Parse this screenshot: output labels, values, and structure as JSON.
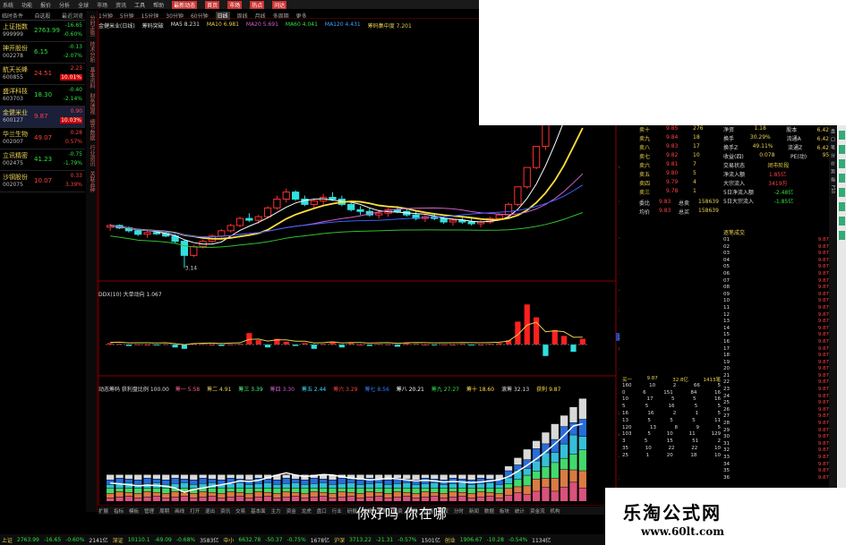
{
  "menu": [
    "系统",
    "功能",
    "报价",
    "分析",
    "全球",
    "市场",
    "资讯",
    "工具",
    "帮助",
    "最新动态",
    "首页",
    "市场",
    "热点",
    "问达"
  ],
  "left_header": {
    "col1": "临时条件",
    "col2": "自选股",
    "col3": "最近浏览"
  },
  "stocks": [
    {
      "name": "上证指数",
      "code": "999999",
      "price": "2763.99",
      "change": "-16.65",
      "pct": "-0.60%",
      "dir": "dn",
      "boxed": false,
      "selected": false
    },
    {
      "name": "神开股份",
      "code": "002278",
      "price": "6.15",
      "change": "-0.13",
      "pct": "-2.07%",
      "dir": "dn",
      "boxed": false,
      "selected": false
    },
    {
      "name": "航天长峰",
      "code": "600855",
      "price": "24.51",
      "change": "2.23",
      "pct": "10.01%",
      "dir": "up",
      "boxed": true,
      "selected": false
    },
    {
      "name": "盛洋科技",
      "code": "603703",
      "price": "18.30",
      "change": "-0.40",
      "pct": "-2.14%",
      "dir": "dn",
      "boxed": false,
      "selected": false
    },
    {
      "name": "金健米业",
      "code": "600127",
      "price": "9.87",
      "change": "0.90",
      "pct": "10.03%",
      "dir": "up",
      "boxed": true,
      "selected": true
    },
    {
      "name": "华兰生物",
      "code": "002007",
      "price": "49.07",
      "change": "0.28",
      "pct": "0.57%",
      "dir": "up",
      "boxed": false,
      "selected": false
    },
    {
      "name": "立讯精密",
      "code": "002475",
      "price": "41.23",
      "change": "-0.75",
      "pct": "-1.79%",
      "dir": "dn",
      "boxed": false,
      "selected": false
    },
    {
      "name": "沙钢股份",
      "code": "002075",
      "price": "10.07",
      "change": "0.33",
      "pct": "3.39%",
      "dir": "up",
      "boxed": false,
      "selected": false
    }
  ],
  "vtabs": [
    "分时走势",
    "技术分析",
    "基本资料",
    "财务透视",
    "细节数据",
    "行业资讯",
    "关联品种"
  ],
  "period_tabs": [
    "1分钟",
    "5分钟",
    "15分钟",
    "30分钟",
    "60分钟",
    "日线",
    "周线",
    "月线",
    "多周期",
    "更多"
  ],
  "active_period": "日线",
  "info": {
    "name": "金健米业(日线)",
    "ind": "筹码突破",
    "ma5": "MA5 8.231",
    "ma10": "MA10 6.981",
    "ma20": "MA20 5.691",
    "ma60": "MA60 4.041",
    "ma120": "MA120 4.431",
    "extra": "筹码集中度 7.201"
  },
  "price_labels": {
    "high": "7.44  7.73",
    "low": "3.14"
  },
  "axis_right": [
    "9.00",
    "8.00",
    "7.00",
    "6.00",
    "5.00",
    "4.00",
    "3.00"
  ],
  "panel2": {
    "title": "DDX(10) 大单动向 1.067",
    "right_tag": "2.73",
    "ticks": [
      "450",
      "2.50",
      "1.50",
      "0.50",
      "-0.50"
    ]
  },
  "panel3": {
    "title": "动态筹码 获利盘比例 100.00",
    "items": [
      "筹一 5.58",
      "筹二 4.91",
      "筹三 3.39",
      "筹四 3.30",
      "筹五 2.44",
      "筹六 3.29",
      "筹七 8.56",
      "筹八 20.21",
      "筹九 27.27",
      "筹十 18.60",
      "滚筹 32.13",
      "获利 9.87"
    ]
  },
  "order_book": {
    "sells": [
      [
        "卖十",
        "9.85",
        "276"
      ],
      [
        "卖九",
        "9.84",
        "18"
      ],
      [
        "卖八",
        "9.83",
        "17"
      ],
      [
        "卖七",
        "9.82",
        "10"
      ],
      [
        "卖六",
        "9.81",
        "7"
      ],
      [
        "卖五",
        "9.80",
        "5"
      ],
      [
        "卖四",
        "9.79",
        "4"
      ],
      [
        "卖三",
        "9.78",
        "1"
      ]
    ],
    "mid": [
      [
        "委比",
        "9.83",
        "总卖",
        "158639"
      ],
      [
        "均价",
        "9.83",
        "总买",
        "158639"
      ]
    ]
  },
  "fund": [
    [
      "净资",
      "1.18",
      "股本",
      "6.42亿"
    ],
    [
      "换手",
      "30.29%",
      "流通A",
      "6.42亿"
    ],
    [
      "换手Z",
      "49.11%",
      "流通Z",
      "6.42亿"
    ],
    [
      "收益(四)",
      "0.078",
      "PE(动)",
      "95.1"
    ],
    [
      "交易状态",
      "闭市阶段",
      "",
      " "
    ],
    [
      "净流入额",
      "1.85亿",
      "",
      ""
    ],
    [
      "大宗流入",
      "3419万",
      "",
      ""
    ],
    [
      "5日净流入额",
      "-2.48亿",
      "",
      ""
    ],
    [
      "5日大宗流入",
      "-1.85亿",
      "",
      ""
    ]
  ],
  "trades_title": "逐笔成交",
  "trades": [
    "9.87",
    "9.87",
    "9.87",
    "9.87",
    "9.87",
    "9.87",
    "9.87",
    "9.87",
    "9.87",
    "9.87",
    "9.87",
    "9.87",
    "9.87",
    "9.87",
    "9.87",
    "9.87",
    "9.87",
    "9.87",
    "9.87",
    "9.87",
    "9.87",
    "9.87",
    "9.87",
    "9.87",
    "9.87",
    "9.87",
    "9.87",
    "9.87",
    "9.87",
    "9.87",
    "9.87",
    "9.87",
    "9.87",
    "9.87",
    "9.87",
    "9.87"
  ],
  "depth_head": [
    "买一",
    "9.87",
    "32.8亿",
    "1413笔"
  ],
  "depth": [
    [
      "160",
      "10",
      "2",
      "66",
      "5"
    ],
    [
      "0",
      "6",
      "151",
      "84",
      "16"
    ],
    [
      "10",
      "17",
      "5",
      "5",
      "16"
    ],
    [
      "5",
      "5",
      "16",
      "5",
      "5"
    ],
    [
      "16",
      "16",
      "2",
      "1",
      "5"
    ],
    [
      "13",
      "5",
      "5",
      "5",
      "11"
    ],
    [
      "120",
      "13",
      "8",
      "9",
      "5"
    ],
    [
      "103",
      "5",
      "10",
      "11",
      "129"
    ],
    [
      "3",
      "5",
      "15",
      "51",
      "2"
    ],
    [
      "35",
      "10",
      "22",
      "22",
      "10"
    ],
    [
      "25",
      "1",
      "20",
      "18",
      "10"
    ]
  ],
  "bottom_tabs": [
    "扩展",
    "指标",
    "模板",
    "管理",
    "周期",
    "画线",
    "打开",
    "退出",
    "资讯",
    "交易",
    "基本面",
    "主力",
    "资金",
    "龙虎",
    "盘口",
    "行业",
    "研报",
    "选股",
    "预警",
    "融资",
    "风险",
    "行情",
    "复权",
    "分时",
    "新闻",
    "数据",
    "板块",
    "统计",
    "资金流",
    "机构"
  ],
  "overlay_text": "你好吗  你在哪",
  "status": [
    {
      "t": "上证",
      "c": "yl"
    },
    {
      "t": "2763.99",
      "c": "dn"
    },
    {
      "t": "-16.65",
      "c": "dn"
    },
    {
      "t": "-0.60%",
      "c": "dn"
    },
    {
      "t": "2141亿",
      "c": "wt"
    },
    {
      "t": "深证",
      "c": "yl"
    },
    {
      "t": "10110.1",
      "c": "dn"
    },
    {
      "t": "-69.09",
      "c": "dn"
    },
    {
      "t": "-0.68%",
      "c": "dn"
    },
    {
      "t": "3583亿",
      "c": "wt"
    },
    {
      "t": "中小",
      "c": "yl"
    },
    {
      "t": "6632.78",
      "c": "dn"
    },
    {
      "t": "-50.37",
      "c": "dn"
    },
    {
      "t": "-0.75%",
      "c": "dn"
    },
    {
      "t": "1678亿",
      "c": "wt"
    },
    {
      "t": "沪深",
      "c": "yl"
    },
    {
      "t": "3713.22",
      "c": "dn"
    },
    {
      "t": "-21.31",
      "c": "dn"
    },
    {
      "t": "-0.57%",
      "c": "dn"
    },
    {
      "t": "1501亿",
      "c": "wt"
    },
    {
      "t": "创业",
      "c": "yl"
    },
    {
      "t": "1906.67",
      "c": "dn"
    },
    {
      "t": "-10.28",
      "c": "dn"
    },
    {
      "t": "-0.54%",
      "c": "dn"
    },
    {
      "t": "1134亿",
      "c": "wt"
    }
  ],
  "watermark": {
    "cn": "乐淘公式网",
    "url": "www.60lt.com"
  },
  "chart_data": {
    "type": "candlestick",
    "title": "金健米业(日线)",
    "candles": [
      [
        4.3,
        4.4,
        4.2,
        4.35
      ],
      [
        4.35,
        4.38,
        4.25,
        4.28
      ],
      [
        4.28,
        4.32,
        4.15,
        4.2
      ],
      [
        4.2,
        4.25,
        4.05,
        4.1
      ],
      [
        4.1,
        4.2,
        4.0,
        4.15
      ],
      [
        4.15,
        4.22,
        4.08,
        4.12
      ],
      [
        4.12,
        4.18,
        4.02,
        4.05
      ],
      [
        4.05,
        4.1,
        3.85,
        3.9
      ],
      [
        3.9,
        3.95,
        3.14,
        3.5
      ],
      [
        3.5,
        3.8,
        3.45,
        3.75
      ],
      [
        3.75,
        3.95,
        3.7,
        3.9
      ],
      [
        3.9,
        4.1,
        3.85,
        4.05
      ],
      [
        4.05,
        4.25,
        4.0,
        4.2
      ],
      [
        4.2,
        4.4,
        4.15,
        4.35
      ],
      [
        4.35,
        4.6,
        4.3,
        4.55
      ],
      [
        4.55,
        4.7,
        4.45,
        4.5
      ],
      [
        4.5,
        4.65,
        4.4,
        4.6
      ],
      [
        4.6,
        4.9,
        4.55,
        4.85
      ],
      [
        4.85,
        5.2,
        4.8,
        5.1
      ],
      [
        5.1,
        5.4,
        5.0,
        5.3
      ],
      [
        5.3,
        5.35,
        5.05,
        5.1
      ],
      [
        5.1,
        5.2,
        4.9,
        4.95
      ],
      [
        4.95,
        5.1,
        4.85,
        5.05
      ],
      [
        5.05,
        5.25,
        4.95,
        5.15
      ],
      [
        5.15,
        5.3,
        5.05,
        5.1
      ],
      [
        5.1,
        5.2,
        4.9,
        4.95
      ],
      [
        4.95,
        5.05,
        4.75,
        4.8
      ],
      [
        4.8,
        4.9,
        4.65,
        4.75
      ],
      [
        4.75,
        4.85,
        4.6,
        4.65
      ],
      [
        4.65,
        4.8,
        4.55,
        4.7
      ],
      [
        4.7,
        4.85,
        4.6,
        4.8
      ],
      [
        4.8,
        4.9,
        4.7,
        4.75
      ],
      [
        4.75,
        4.85,
        4.6,
        4.65
      ],
      [
        4.65,
        4.75,
        4.5,
        4.55
      ],
      [
        4.55,
        4.65,
        4.45,
        4.6
      ],
      [
        4.6,
        4.7,
        4.5,
        4.55
      ],
      [
        4.55,
        4.6,
        4.4,
        4.45
      ],
      [
        4.45,
        4.55,
        4.35,
        4.5
      ],
      [
        4.5,
        4.6,
        4.4,
        4.45
      ],
      [
        4.45,
        4.55,
        4.35,
        4.4
      ],
      [
        4.4,
        4.5,
        4.3,
        4.45
      ],
      [
        4.45,
        4.6,
        4.4,
        4.55
      ],
      [
        4.55,
        4.7,
        4.5,
        4.65
      ],
      [
        4.65,
        5.0,
        4.6,
        4.95
      ],
      [
        4.95,
        5.45,
        4.9,
        5.45
      ],
      [
        5.45,
        6.0,
        5.4,
        6.0
      ],
      [
        6.0,
        6.6,
        5.95,
        6.6
      ],
      [
        6.6,
        7.26,
        6.5,
        7.26
      ],
      [
        7.26,
        7.99,
        7.2,
        7.99
      ],
      [
        7.99,
        8.79,
        7.9,
        8.79
      ],
      [
        8.79,
        9.67,
        8.7,
        9.67
      ],
      [
        9.67,
        9.87,
        9.4,
        9.87
      ]
    ],
    "ddx": [
      0.1,
      0.05,
      -0.1,
      0.02,
      0.0,
      -0.05,
      0.03,
      -0.2,
      -0.3,
      0.1,
      0.05,
      0.0,
      -0.1,
      0.02,
      0.05,
      0.8,
      0.3,
      -0.2,
      0.4,
      0.2,
      -0.1,
      0.1,
      -0.3,
      0.05,
      0.2,
      -0.2,
      0.1,
      0.0,
      -0.1,
      0.05,
      0.02,
      -0.15,
      0.1,
      0.05,
      0.0,
      -0.05,
      0.02,
      0.0,
      0.05,
      -0.02,
      0.0,
      0.05,
      0.1,
      0.3,
      1.6,
      2.8,
      1.9,
      -0.8,
      1.0,
      0.6,
      -0.5,
      0.4
    ],
    "ylim": [
      3.0,
      10.0
    ]
  }
}
